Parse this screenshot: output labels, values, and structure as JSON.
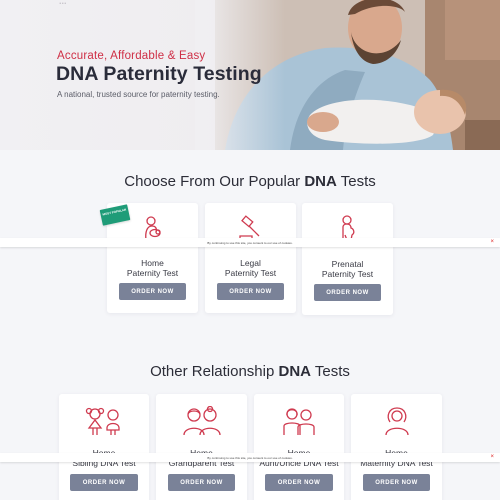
{
  "hero": {
    "logo": "...",
    "tagline": "Accurate, Affordable & Easy",
    "title": "DNA Paternity Testing",
    "subtitle": "A national, trusted source for paternity testing."
  },
  "popular": {
    "heading_prefix": "Choose From Our Popular ",
    "heading_bold": "DNA",
    "heading_suffix": " Tests",
    "ribbon": "MOST POPULAR",
    "cards": [
      {
        "line1": "Home",
        "line2": "Paternity Test",
        "button": "ORDER NOW",
        "icon": "mother-baby-icon"
      },
      {
        "line1": "Legal",
        "line2": "Paternity Test",
        "button": "ORDER NOW",
        "icon": "gavel-icon"
      },
      {
        "line1": "Prenatal",
        "line2": "Paternity Test",
        "button": "ORDER NOW",
        "icon": "pregnant-woman-icon"
      }
    ]
  },
  "other": {
    "heading_prefix": "Other Relationship ",
    "heading_bold": "DNA",
    "heading_suffix": " Tests",
    "cards": [
      {
        "line1": "Home",
        "line2": "Sibling DNA Test",
        "button": "ORDER NOW",
        "icon": "siblings-icon"
      },
      {
        "line1": "Home",
        "line2": "Grandparent Test",
        "button": "ORDER NOW",
        "icon": "grandparents-icon"
      },
      {
        "line1": "Home",
        "line2": "Aunt/Uncle DNA Test",
        "button": "ORDER NOW",
        "icon": "aunt-uncle-icon"
      },
      {
        "line1": "Home",
        "line2": "Maternity DNA Test",
        "button": "ORDER NOW",
        "icon": "mother-icon"
      }
    ]
  },
  "cookie": {
    "text": "By continuing to use this site, you consent to our use of cookies.",
    "close": "×"
  },
  "colors": {
    "accent": "#cf2f46",
    "button": "#7a8298",
    "ribbon": "#1f9c78",
    "icon_stroke": "#cf3a4f"
  }
}
